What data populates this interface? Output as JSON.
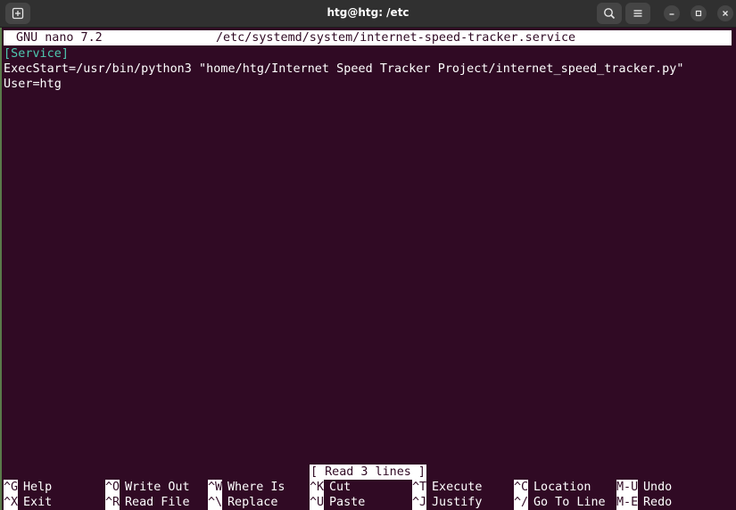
{
  "titlebar": {
    "title": "htg@htg: /etc",
    "new_tab_icon": "new-tab-icon",
    "search_icon": "search-icon",
    "menu_icon": "hamburger-menu-icon",
    "minimize_icon": "minimize-icon",
    "maximize_icon": "maximize-icon",
    "close_icon": "close-icon"
  },
  "nano": {
    "version": "GNU nano 7.2",
    "filename": "/etc/systemd/system/internet-speed-tracker.service",
    "lines": [
      "[Service]",
      "ExecStart=/usr/bin/python3 \"home/htg/Internet Speed Tracker Project/internet_speed_tracker.py\"",
      "User=htg"
    ],
    "status": "[ Read 3 lines ]",
    "shortcuts_row1": [
      {
        "key": "^G",
        "label": "Help"
      },
      {
        "key": "^O",
        "label": "Write Out"
      },
      {
        "key": "^W",
        "label": "Where Is"
      },
      {
        "key": "^K",
        "label": "Cut"
      },
      {
        "key": "^T",
        "label": "Execute"
      },
      {
        "key": "^C",
        "label": "Location"
      },
      {
        "key": "M-U",
        "label": "Undo"
      }
    ],
    "shortcuts_row2": [
      {
        "key": "^X",
        "label": "Exit"
      },
      {
        "key": "^R",
        "label": "Read File"
      },
      {
        "key": "^\\",
        "label": "Replace"
      },
      {
        "key": "^U",
        "label": "Paste"
      },
      {
        "key": "^J",
        "label": "Justify"
      },
      {
        "key": "^/",
        "label": "Go To Line"
      },
      {
        "key": "M-E",
        "label": "Redo"
      }
    ]
  },
  "colors": {
    "background": "#300a24",
    "text": "#ffffff",
    "section_header": "#4ec9b0",
    "titlebar": "#303030"
  }
}
